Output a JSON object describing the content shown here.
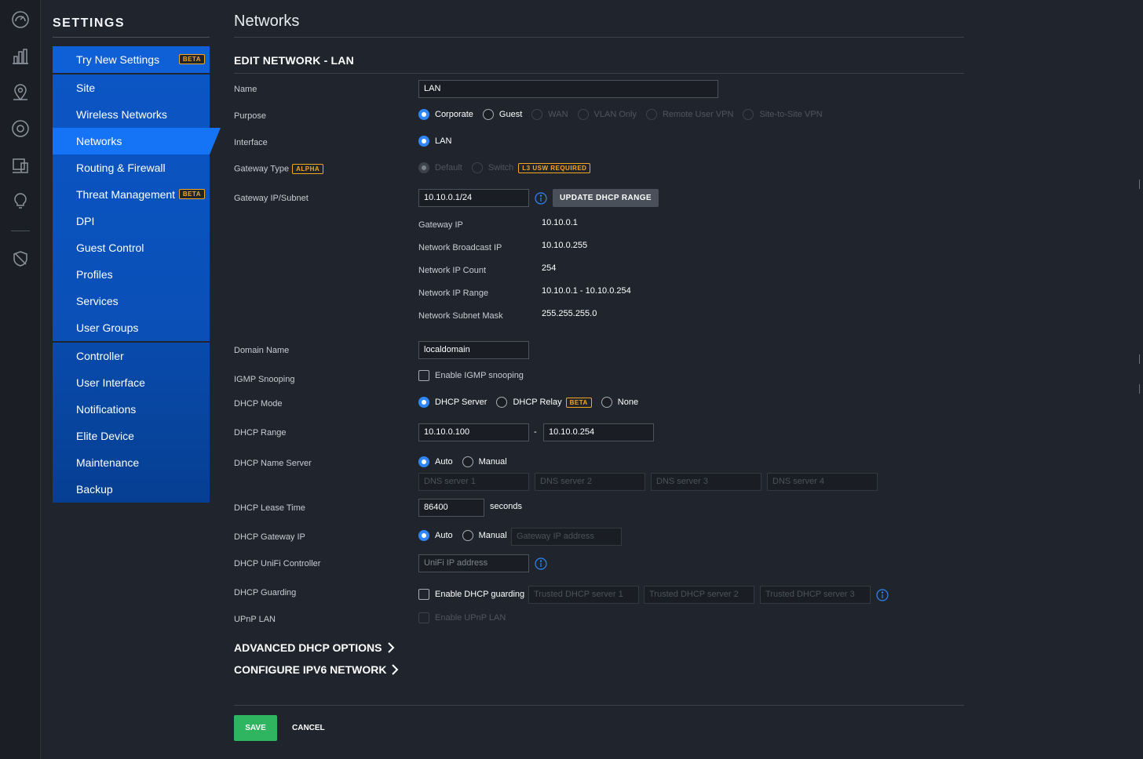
{
  "sidebar": {
    "title": "SETTINGS",
    "group1": [
      {
        "label": "Try New Settings",
        "badge": "BETA"
      }
    ],
    "group2": [
      {
        "label": "Site"
      },
      {
        "label": "Wireless Networks"
      },
      {
        "label": "Networks",
        "active": true
      },
      {
        "label": "Routing & Firewall"
      },
      {
        "label": "Threat Management",
        "badge": "BETA"
      },
      {
        "label": "DPI"
      },
      {
        "label": "Guest Control"
      },
      {
        "label": "Profiles"
      },
      {
        "label": "Services"
      },
      {
        "label": "User Groups"
      }
    ],
    "group3": [
      {
        "label": "Controller"
      },
      {
        "label": "User Interface"
      },
      {
        "label": "Notifications"
      },
      {
        "label": "Elite Device"
      },
      {
        "label": "Maintenance"
      },
      {
        "label": "Backup"
      }
    ]
  },
  "rail_icons": [
    "dashboard-icon",
    "statistics-icon",
    "map-icon",
    "devices-icon",
    "clients-icon",
    "insights-icon",
    "events-icon"
  ],
  "page": {
    "title": "Networks",
    "section": "EDIT NETWORK - LAN"
  },
  "form": {
    "name": {
      "label": "Name",
      "value": "LAN"
    },
    "purpose": {
      "label": "Purpose",
      "options": [
        "Corporate",
        "Guest",
        "WAN",
        "VLAN Only",
        "Remote User VPN",
        "Site-to-Site VPN"
      ],
      "selected": "Corporate"
    },
    "interface": {
      "label": "Interface",
      "option": "LAN"
    },
    "gateway_type": {
      "label": "Gateway Type",
      "badge": "ALPHA",
      "options": [
        "Default",
        "Switch"
      ],
      "switch_badge": "L3 USW REQUIRED"
    },
    "gateway_ip": {
      "label": "Gateway IP/Subnet",
      "value": "10.10.0.1/24",
      "button": "UPDATE DHCP RANGE"
    },
    "details": [
      {
        "label": "Gateway IP",
        "value": "10.10.0.1"
      },
      {
        "label": "Network Broadcast IP",
        "value": "10.10.0.255"
      },
      {
        "label": "Network IP Count",
        "value": "254"
      },
      {
        "label": "Network IP Range",
        "value": "10.10.0.1 - 10.10.0.254"
      },
      {
        "label": "Network Subnet Mask",
        "value": "255.255.255.0"
      }
    ],
    "domain_name": {
      "label": "Domain Name",
      "value": "localdomain"
    },
    "igmp": {
      "label": "IGMP Snooping",
      "checkbox": "Enable IGMP snooping"
    },
    "dhcp_mode": {
      "label": "DHCP Mode",
      "options": [
        "DHCP Server",
        "DHCP Relay",
        "None"
      ],
      "relay_badge": "BETA"
    },
    "dhcp_range": {
      "label": "DHCP Range",
      "start": "10.10.0.100",
      "separator": "-",
      "end": "10.10.0.254"
    },
    "dhcp_name_server": {
      "label": "DHCP Name Server",
      "options": [
        "Auto",
        "Manual"
      ],
      "placeholders": [
        "DNS server 1",
        "DNS server 2",
        "DNS server 3",
        "DNS server 4"
      ]
    },
    "lease_time": {
      "label": "DHCP Lease Time",
      "value": "86400",
      "unit": "seconds"
    },
    "gateway": {
      "label": "DHCP Gateway IP",
      "options": [
        "Auto",
        "Manual"
      ],
      "placeholder": "Gateway IP address"
    },
    "unifi_controller": {
      "label": "DHCP UniFi Controller",
      "placeholder": "UniFi IP address"
    },
    "guarding": {
      "label": "DHCP Guarding",
      "checkbox": "Enable DHCP guarding",
      "placeholders": [
        "Trusted DHCP server 1",
        "Trusted DHCP server 2",
        "Trusted DHCP server 3"
      ]
    },
    "upnp": {
      "label": "UPnP LAN",
      "checkbox": "Enable UPnP LAN"
    }
  },
  "expanders": [
    "ADVANCED DHCP OPTIONS",
    "CONFIGURE IPV6 NETWORK"
  ],
  "actions": {
    "save": "SAVE",
    "cancel": "CANCEL"
  },
  "colors": {
    "accent": "#1574f5",
    "save": "#2fb55f",
    "badge": "#f5a623"
  }
}
